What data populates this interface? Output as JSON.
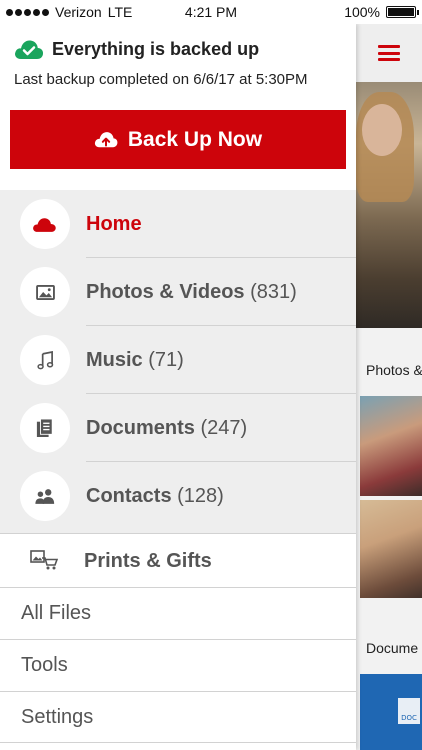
{
  "status_bar": {
    "carrier": "Verizon",
    "network": "LTE",
    "time": "4:21 PM",
    "battery_percent": "100%",
    "battery_level": 1.0
  },
  "drawer": {
    "backup_title": "Everything is backed up",
    "backup_subtitle": "Last backup completed on 6/6/17 at 5:30PM",
    "backup_button": "Back Up Now",
    "menu_items": [
      {
        "label": "Home",
        "count": "",
        "icon": "cloud-icon",
        "active": true
      },
      {
        "label": "Photos & Videos",
        "count": "(831)",
        "icon": "photo-icon",
        "active": false
      },
      {
        "label": "Music",
        "count": "(71)",
        "icon": "music-note-icon",
        "active": false
      },
      {
        "label": "Documents",
        "count": "(247)",
        "icon": "documents-icon",
        "active": false
      },
      {
        "label": "Contacts",
        "count": "(128)",
        "icon": "contacts-icon",
        "active": false
      }
    ],
    "prints_label": "Prints & Gifts",
    "links": [
      "All Files",
      "Tools",
      "Settings"
    ]
  },
  "background": {
    "section_photos": "Photos &",
    "section_documents": "Docume",
    "doc_badge": "DOC"
  },
  "colors": {
    "brand_red": "#cd040b",
    "success_green": "#1aa55d",
    "menu_bg": "#eeeeee"
  }
}
